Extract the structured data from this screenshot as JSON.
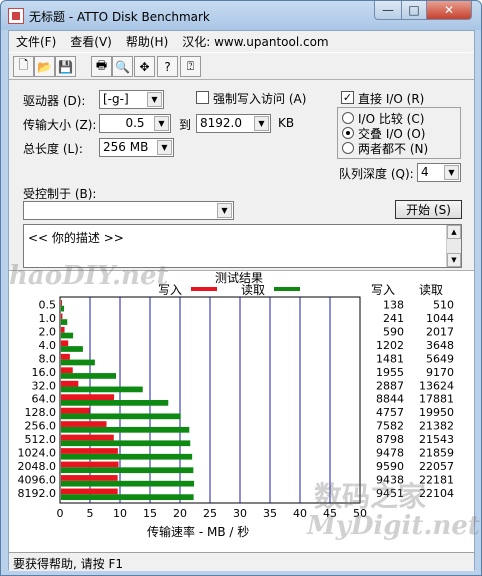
{
  "window": {
    "title": "无标题 - ATTO Disk Benchmark",
    "minimize": "—",
    "maximize": "□",
    "close": "✕"
  },
  "menu": [
    "文件(F)",
    "查看(V)",
    "帮助(H)",
    "汉化: www.upantool.com"
  ],
  "toolbar_icons": [
    "new-icon",
    "open-icon",
    "save-icon",
    "print-icon",
    "print-preview-icon",
    "move-icon",
    "help-icon",
    "context-help-icon"
  ],
  "form": {
    "drive_label": "驱动器 (D):",
    "drive_value": "[-g-]",
    "force_write_label": "强制写入访问 (A)",
    "transfer_label": "传输大小 (Z):",
    "transfer_from": "0.5",
    "to_label": "到",
    "transfer_to": "8192.0",
    "kb_label": "KB",
    "length_label": "总长度 (L):",
    "length_value": "256 MB",
    "direct_io_label": "直接 I/O (R)",
    "io_compare_label": "I/O 比较 (C)",
    "overlap_io_label": "交叠 I/O (O)",
    "neither_label": "两者都不 (N)",
    "queue_depth_label": "队列深度 (Q):",
    "queue_depth_value": "4",
    "controlled_by_label": "受控制于 (B):",
    "controlled_by_value": "",
    "start_button": "开始 (S)",
    "description": "<<   你的描述    >>"
  },
  "results": {
    "title": "测试结果",
    "write_legend": "写入",
    "read_legend": "读取",
    "write_col": "写入",
    "read_col": "读取",
    "xlabel": "传输速率 - MB / 秒",
    "watermark_left": "haoDIY.net",
    "watermark_cn": "数码之家",
    "watermark_en": "MyDigit.net"
  },
  "chart_data": {
    "type": "bar",
    "categories": [
      "0.5",
      "1.0",
      "2.0",
      "4.0",
      "8.0",
      "16.0",
      "32.0",
      "64.0",
      "128.0",
      "256.0",
      "512.0",
      "1024.0",
      "2048.0",
      "4096.0",
      "8192.0"
    ],
    "series": [
      {
        "name": "写入",
        "color": "#e8141e",
        "values": [
          138,
          241,
          590,
          1202,
          1481,
          1955,
          2887,
          8844,
          4757,
          7582,
          8798,
          9478,
          9590,
          9438,
          9451
        ]
      },
      {
        "name": "读取",
        "color": "#0e8a13",
        "values": [
          510,
          1044,
          2017,
          3648,
          5649,
          9170,
          13624,
          17881,
          19950,
          21382,
          21543,
          21859,
          22057,
          22181,
          22104
        ]
      }
    ],
    "xlim": [
      0,
      50
    ],
    "x_ticks": [
      "0",
      "5",
      "10",
      "15",
      "20",
      "25",
      "30",
      "35",
      "40",
      "45",
      "50"
    ],
    "xlabel": "传输速率 - MB / 秒",
    "value_unit": "KB/s",
    "legend": "top"
  },
  "status": "要获得帮助, 请按 F1"
}
